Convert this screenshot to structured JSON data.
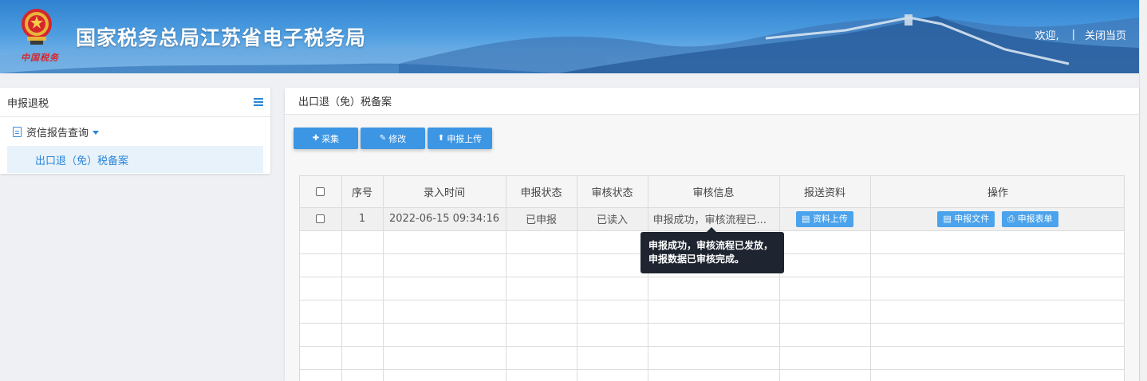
{
  "header": {
    "title": "国家税务总局江苏省电子税务局",
    "emblem_caption": "中国税务",
    "welcome": "欢迎,",
    "close_page": "关闭当页"
  },
  "sidebar": {
    "title": "申报退税",
    "menu": {
      "label": "资信报告查询",
      "items": [
        "出口退（免）税备案"
      ]
    }
  },
  "main": {
    "breadcrumb": "出口退（免）税备案",
    "toolbar": {
      "collect": "采集",
      "modify": "修改",
      "upload": "申报上传"
    },
    "table": {
      "columns": [
        "序号",
        "录入时间",
        "申报状态",
        "审核状态",
        "审核信息",
        "报送资料",
        "操作"
      ],
      "rows": [
        {
          "index": "1",
          "entry_time": "2022-06-15 09:34:16",
          "declare_status": "已申报",
          "review_status": "已读入",
          "review_info": "申报成功，审核流程已...",
          "materials_button": "资料上传",
          "actions": [
            "申报文件",
            "申报表单"
          ]
        }
      ]
    },
    "tooltip": "申报成功，审核流程已发放，申报数据已审核完成。"
  },
  "colors": {
    "primary": "#3d96e4",
    "header_top": "#2f82cf",
    "tooltip_bg": "#1f2530"
  }
}
